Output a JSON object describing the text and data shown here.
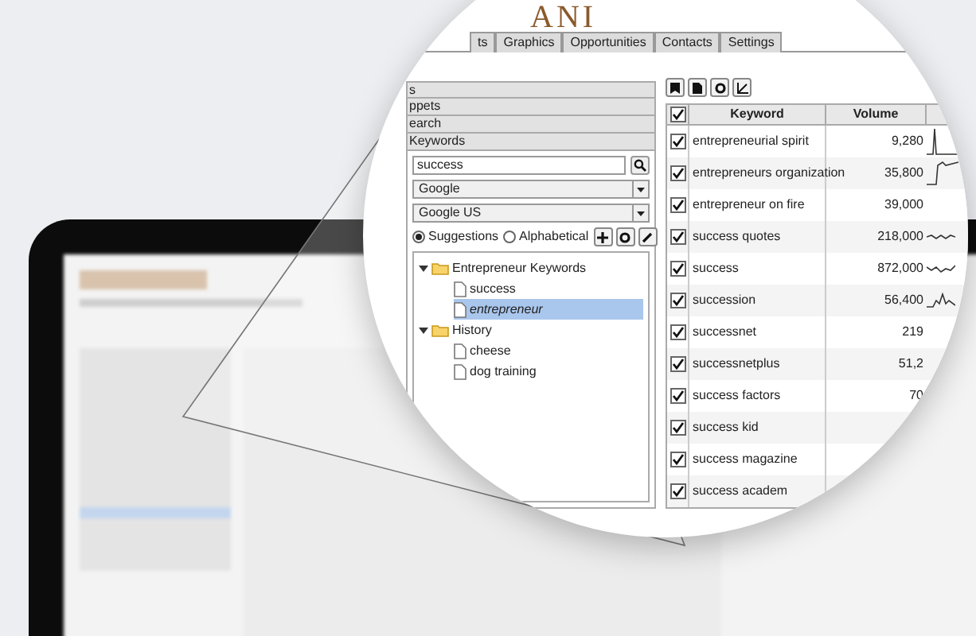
{
  "logo": {
    "text": "ANI"
  },
  "tabs": [
    {
      "label": "ts"
    },
    {
      "label": "Graphics"
    },
    {
      "label": "Opportunities"
    },
    {
      "label": "Contacts"
    },
    {
      "label": "Settings"
    }
  ],
  "sidebar": {
    "sections": [
      {
        "label": "s"
      },
      {
        "label": "ppets"
      },
      {
        "label": "earch"
      },
      {
        "label": "Keywords"
      }
    ],
    "search": {
      "value": "success"
    },
    "engine": {
      "value": "Google"
    },
    "region": {
      "value": "Google US"
    },
    "sort_options": [
      {
        "label": "Suggestions",
        "selected": true
      },
      {
        "label": "Alphabetical",
        "selected": false
      }
    ],
    "tree": [
      {
        "label": "Entrepreneur Keywords",
        "kind": "folder",
        "expanded": true,
        "selected": false,
        "children": [
          {
            "label": "success",
            "kind": "file",
            "selected": false
          },
          {
            "label": "entrepreneur",
            "kind": "file",
            "selected": true
          }
        ]
      },
      {
        "label": "History",
        "kind": "folder",
        "expanded": true,
        "selected": false,
        "children": [
          {
            "label": "cheese",
            "kind": "file",
            "selected": false
          },
          {
            "label": "dog training",
            "kind": "file",
            "selected": false
          }
        ]
      }
    ]
  },
  "table": {
    "all_checked": true,
    "columns": [
      "Keyword",
      "Volume"
    ],
    "rows": [
      {
        "checked": true,
        "keyword": "entrepreneurial spirit",
        "volume": "9,280",
        "sparkline": true
      },
      {
        "checked": true,
        "keyword": "entrepreneurs organization",
        "volume": "35,800",
        "sparkline": true
      },
      {
        "checked": true,
        "keyword": "entrepreneur on fire",
        "volume": "39,000",
        "sparkline": false
      },
      {
        "checked": true,
        "keyword": "success quotes",
        "volume": "218,000",
        "sparkline": true
      },
      {
        "checked": true,
        "keyword": "success",
        "volume": "872,000",
        "sparkline": true
      },
      {
        "checked": true,
        "keyword": "succession",
        "volume": "56,400",
        "sparkline": true
      },
      {
        "checked": true,
        "keyword": "successnet",
        "volume": "219",
        "sparkline": false
      },
      {
        "checked": true,
        "keyword": "successnetplus",
        "volume": "51,2",
        "sparkline": false
      },
      {
        "checked": true,
        "keyword": "success factors",
        "volume": "70",
        "sparkline": false
      },
      {
        "checked": true,
        "keyword": "success kid",
        "volume": "",
        "sparkline": false
      },
      {
        "checked": true,
        "keyword": "success magazine",
        "volume": "",
        "sparkline": false
      },
      {
        "checked": true,
        "keyword": "success academ",
        "volume": "",
        "sparkline": false
      }
    ]
  }
}
